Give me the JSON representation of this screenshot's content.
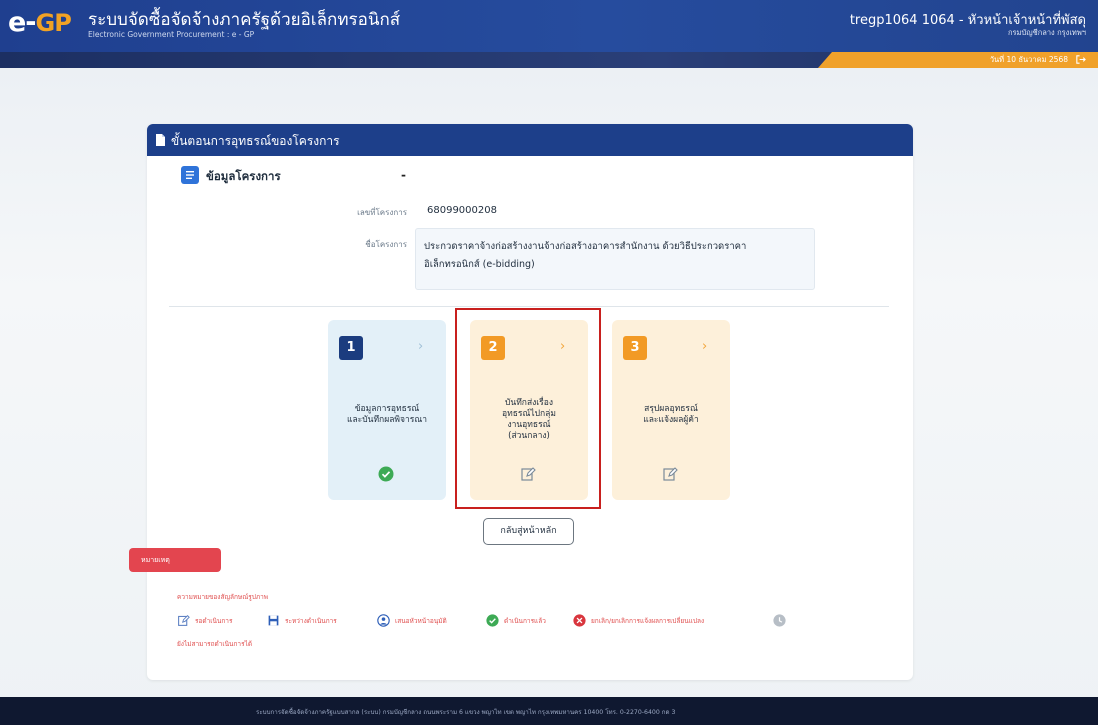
{
  "header": {
    "logo_main": "e-",
    "logo_accent": "GP",
    "system_title": "ระบบจัดซื้อจัดจ้างภาครัฐด้วยอิเล็กทรอนิกส์",
    "system_subtitle": "Electronic Government Procurement : e - GP",
    "user_name": "tregp1064 1064 - หัวหน้าเจ้าหน้าที่พัสดุ",
    "user_department": "กรมบัญชีกลาง กรุงเทพฯ",
    "date": "วันที่ 10 ธันวาคม 2568",
    "logout_icon": "logout-icon"
  },
  "panel": {
    "title": "ขั้นตอนการอุทธรณ์ของโครงการ",
    "title_icon": "document-icon",
    "section_title": "ข้อมูลโครงการ",
    "section_icon": "list-icon",
    "collapse_symbol": "-",
    "project_no_label": "เลขที่โครงการ",
    "project_no": "68099000208",
    "project_name_label": "ชื่อโครงการ",
    "project_name_line1": "ประกวดราคาจ้างก่อสร้างงานจ้างก่อสร้างอาคารสำนักงาน ด้วยวิธีประกวดราคา",
    "project_name_line2": "อิเล็กทรอนิกส์ (e-bidding)"
  },
  "steps": [
    {
      "number": "1",
      "lines": [
        "ข้อมูลการอุทธรณ์",
        "และบันทึกผลพิจารณา"
      ],
      "status_icon": "check-circle-icon",
      "arrow": "›"
    },
    {
      "number": "2",
      "lines": [
        "บันทึกส่งเรื่อง",
        "อุทธรณ์ไปกลุ่ม",
        "งานอุทธรณ์",
        "(ส่วนกลาง)"
      ],
      "status_icon": "edit-icon",
      "arrow": "›"
    },
    {
      "number": "3",
      "lines": [
        "สรุปผลอุทธรณ์",
        "และแจ้งผลผู้ค้า"
      ],
      "status_icon": "edit-icon",
      "arrow": "›"
    }
  ],
  "back_button": "กลับสู่หน้าหลัก",
  "notes": {
    "tab_label": "หมายเหตุ",
    "caption": "ความหมายของสัญลักษณ์รูปภาพ",
    "legend": [
      {
        "icon": "edit-icon",
        "label": "รอดำเนินการ"
      },
      {
        "icon": "save-icon",
        "label": "ระหว่างดำเนินการ"
      },
      {
        "icon": "person-icon",
        "label": "เสนอหัวหน้าอนุมัติ"
      },
      {
        "icon": "check-circle-icon",
        "label": "ดำเนินการแล้ว"
      },
      {
        "icon": "cancel-circle-icon",
        "label": "ยกเลิก/ยกเลิกการแจ้งผลการเปลี่ยนแปลง"
      },
      {
        "icon": "clock-icon",
        "label": ""
      }
    ],
    "footer": "ยังไม่สามารถดำเนินการได้"
  },
  "footer": {
    "text": "ระบบการจัดซื้อจัดจ้างภาครัฐแบบสากล (ระบบ) กรมบัญชีกลาง ถนนพระราม 6 แขวง พญาไท เขต พญาไท กรุงเทพมหานคร 10400 โทร. 0-2270-6400 กด 3"
  },
  "colors": {
    "header_blue": "#1f3f8f",
    "panel_header": "#1d3f8a",
    "step_done": "#1b3c7f",
    "step_pending": "#f29a25",
    "highlight_border": "#c8201e",
    "note_red": "#e3454f"
  }
}
